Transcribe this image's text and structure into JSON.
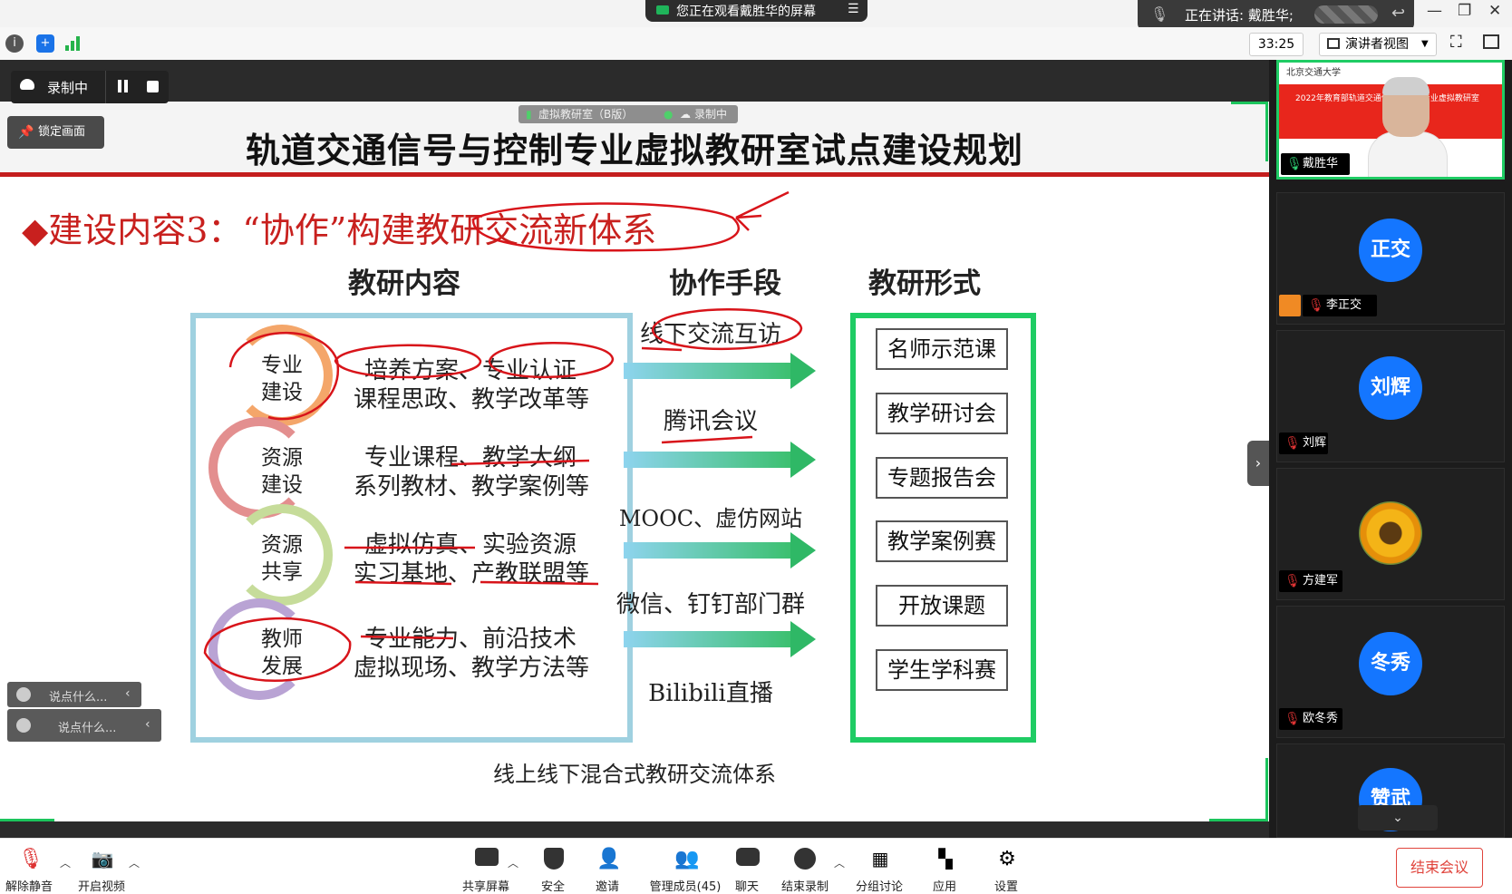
{
  "top": {
    "share_banner": "您正在观看戴胜华的屏幕",
    "speaking": "正在讲话: 戴胜华;",
    "timer": "33:25",
    "presenter_view": "演讲者视图"
  },
  "recording": {
    "label": "录制中",
    "lock_label": "锁定画面",
    "overlay_room": "虚拟教研室（B版）",
    "overlay_rec": "录制中"
  },
  "slide": {
    "title": "轨道交通信号与控制专业虚拟教研室试点建设规划",
    "subtitle": "◆建设内容3：“协作”构建教研交流新体系",
    "col_content": "教研内容",
    "col_method": "协作手段",
    "col_form": "教研形式",
    "rings": [
      {
        "line1": "专业",
        "line2": "建设",
        "color": "#f4a66a"
      },
      {
        "line1": "资源",
        "line2": "建设",
        "color": "#e38f8f"
      },
      {
        "line1": "资源",
        "line2": "共享",
        "color": "#c6dc9a"
      },
      {
        "line1": "教师",
        "line2": "发展",
        "color": "#b9a3d4"
      }
    ],
    "contents": [
      {
        "line1": "培养方案、专业认证",
        "line2": "课程思政、教学改革等"
      },
      {
        "line1": "专业课程、教学大纲",
        "line2": "系列教材、教学案例等"
      },
      {
        "line1": "虚拟仿真、实验资源",
        "line2": "实习基地、产教联盟等"
      },
      {
        "line1": "专业能力、前沿技术",
        "line2": "虚拟现场、教学方法等"
      }
    ],
    "methods": [
      "线下交流互访",
      "腾讯会议",
      "MOOC、虚仿网站",
      "微信、钉钉部门群",
      "Bilibili直播"
    ],
    "forms": [
      "名师示范课",
      "教学研讨会",
      "专题报告会",
      "教学案例赛",
      "开放课题",
      "学生学科赛"
    ],
    "caption": "线上线下混合式教研交流体系"
  },
  "chat": {
    "placeholder": "说点什么..."
  },
  "participants": {
    "speaker": {
      "name": "戴胜华",
      "banner": "2022年教育部轨道交通信号与控制专业虚拟教研室",
      "logo": "北京交通大学"
    },
    "tiles": [
      {
        "avatar": "正交",
        "name": "李正交"
      },
      {
        "avatar": "刘辉",
        "name": "刘辉"
      },
      {
        "avatar": "",
        "name": "方建军"
      },
      {
        "avatar": "冬秀",
        "name": "欧冬秀"
      },
      {
        "avatar": "赞武",
        "name": ""
      }
    ]
  },
  "bottom": {
    "unmute": "解除静音",
    "video": "开启视频",
    "share": "共享屏幕",
    "security": "安全",
    "invite": "邀请",
    "members": "管理成员(45)",
    "chat": "聊天",
    "end_record": "结束录制",
    "breakout": "分组讨论",
    "apps": "应用",
    "settings": "设置",
    "end_meeting": "结束会议"
  }
}
